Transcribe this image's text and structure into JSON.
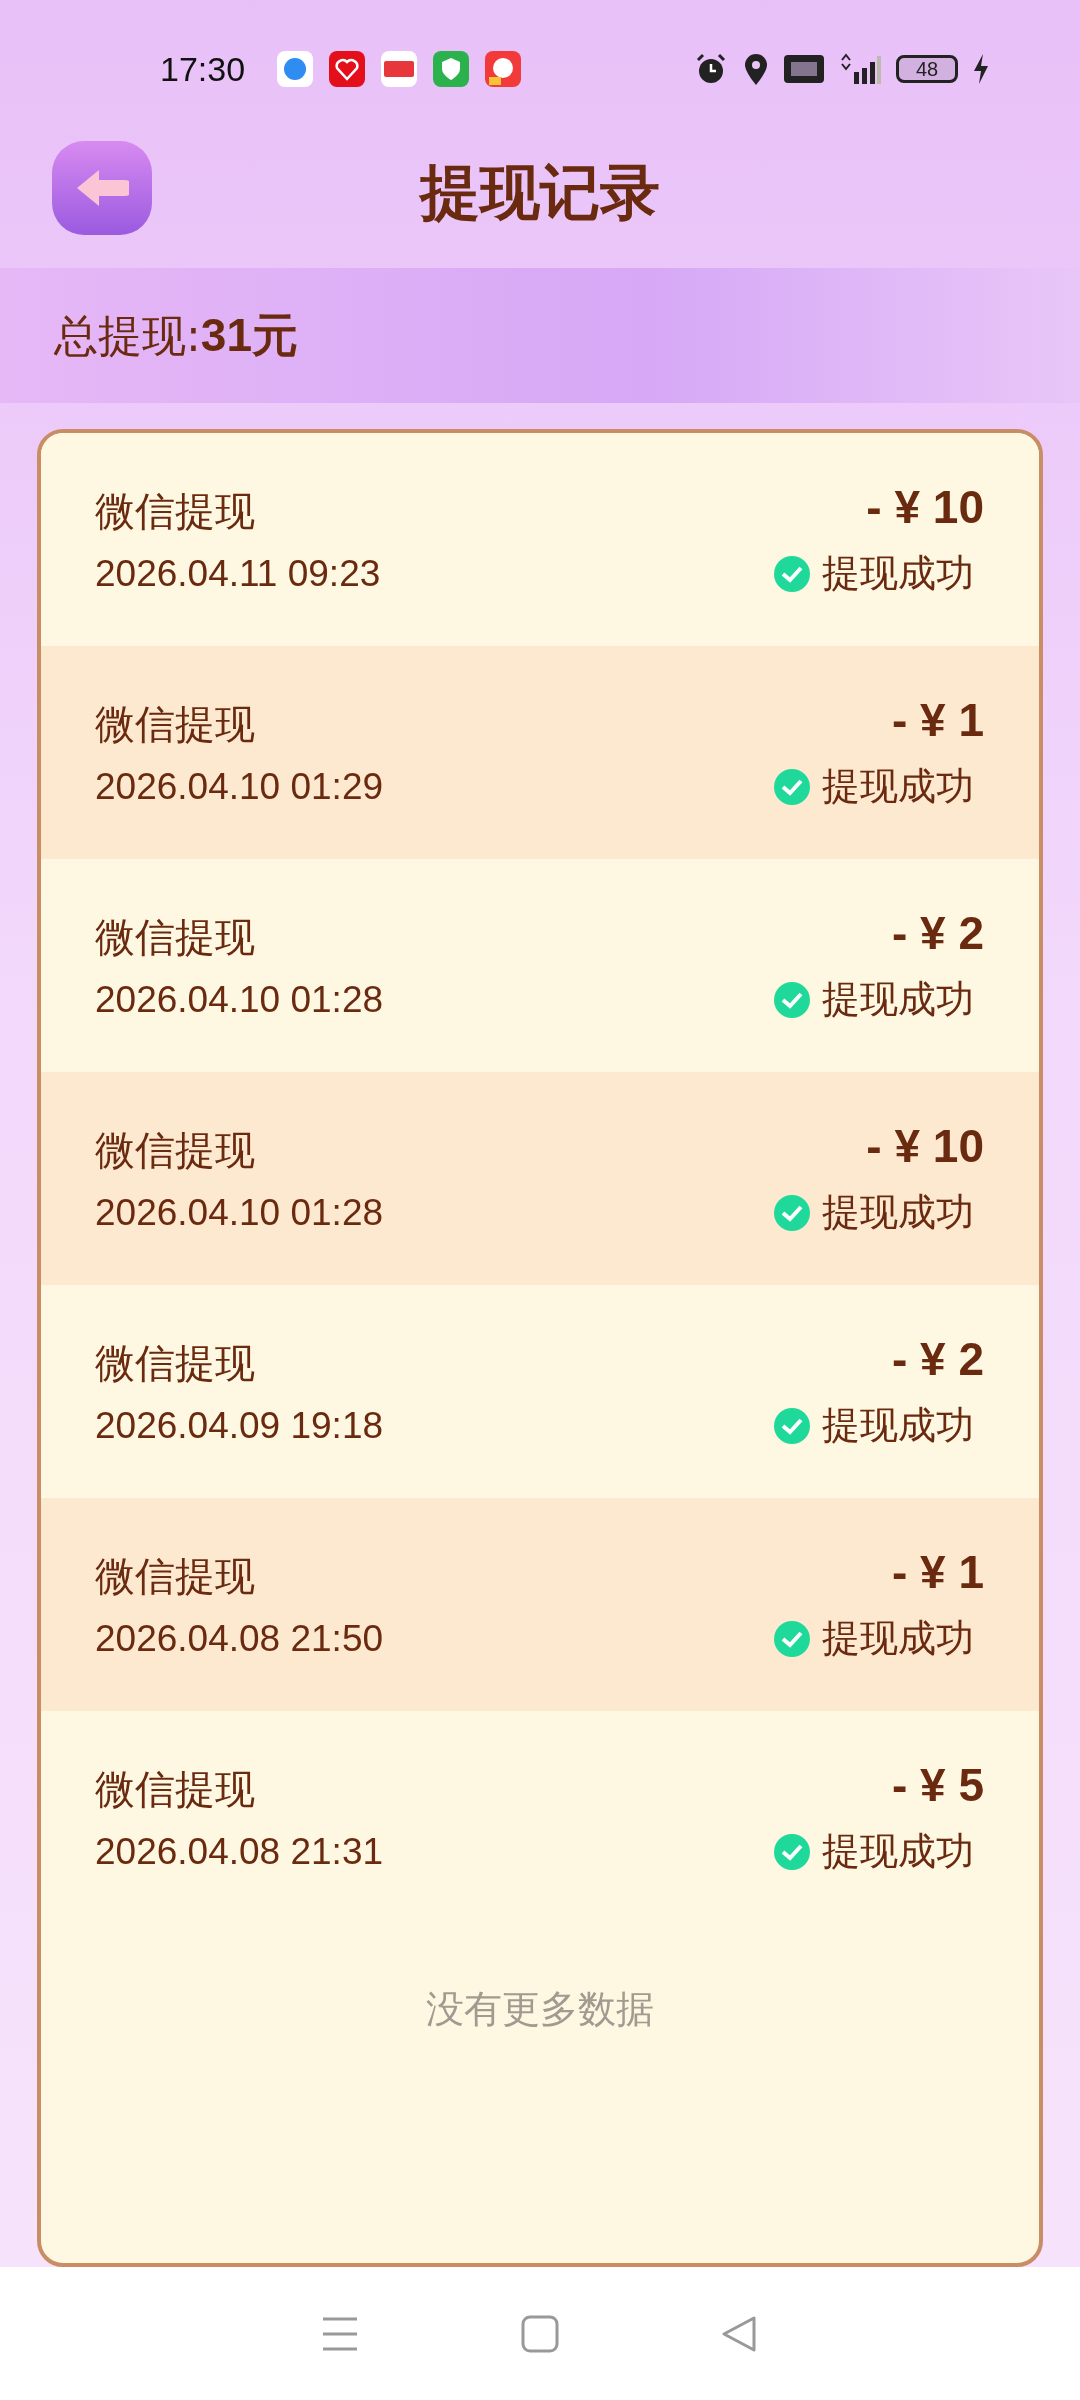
{
  "status_bar": {
    "time": "17:30",
    "battery": "48"
  },
  "header": {
    "title": "提现记录"
  },
  "summary": {
    "label": "总提现:",
    "amount": "31元"
  },
  "records": [
    {
      "title": "微信提现",
      "date": "2026.04.11 09:23",
      "amount": "- ¥ 10",
      "status": "提现成功"
    },
    {
      "title": "微信提现",
      "date": "2026.04.10 01:29",
      "amount": "- ¥ 1",
      "status": "提现成功"
    },
    {
      "title": "微信提现",
      "date": "2026.04.10 01:28",
      "amount": "- ¥ 2",
      "status": "提现成功"
    },
    {
      "title": "微信提现",
      "date": "2026.04.10 01:28",
      "amount": "- ¥ 10",
      "status": "提现成功"
    },
    {
      "title": "微信提现",
      "date": "2026.04.09 19:18",
      "amount": "- ¥ 2",
      "status": "提现成功"
    },
    {
      "title": "微信提现",
      "date": "2026.04.08 21:50",
      "amount": "- ¥ 1",
      "status": "提现成功"
    },
    {
      "title": "微信提现",
      "date": "2026.04.08 21:31",
      "amount": "- ¥ 5",
      "status": "提现成功"
    }
  ],
  "footer_note": "没有更多数据"
}
